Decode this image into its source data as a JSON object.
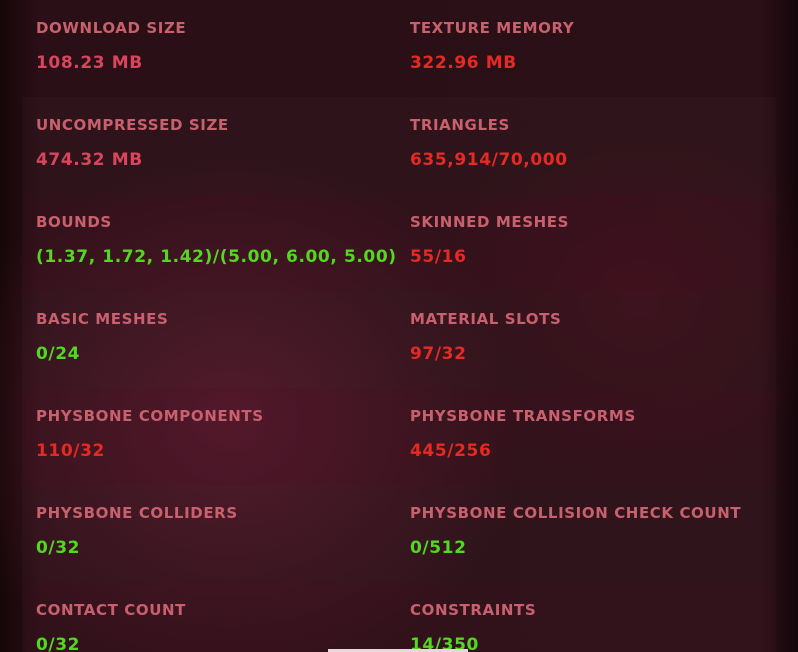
{
  "colors": {
    "label": "#c9606e",
    "value_neutral": "#d8455c",
    "value_over": "#e42a22",
    "value_ok": "#53d822",
    "background": "#1a0b10"
  },
  "stats": [
    {
      "left": {
        "label": "DOWNLOAD SIZE",
        "value": "108.23 MB",
        "status": "neutral"
      },
      "right": {
        "label": "TEXTURE MEMORY",
        "value": "322.96 MB",
        "status": "over"
      }
    },
    {
      "left": {
        "label": "UNCOMPRESSED SIZE",
        "value": "474.32 MB",
        "status": "neutral"
      },
      "right": {
        "label": "TRIANGLES",
        "value": "635,914/70,000",
        "status": "over"
      }
    },
    {
      "left": {
        "label": "BOUNDS",
        "value": "(1.37, 1.72, 1.42)/(5.00, 6.00, 5.00)",
        "status": "ok"
      },
      "right": {
        "label": "SKINNED MESHES",
        "value": "55/16",
        "status": "over"
      }
    },
    {
      "left": {
        "label": "BASIC MESHES",
        "value": "0/24",
        "status": "ok"
      },
      "right": {
        "label": "MATERIAL SLOTS",
        "value": "97/32",
        "status": "over"
      }
    },
    {
      "left": {
        "label": "PHYSBONE COMPONENTS",
        "value": "110/32",
        "status": "over"
      },
      "right": {
        "label": "PHYSBONE TRANSFORMS",
        "value": "445/256",
        "status": "over"
      }
    },
    {
      "left": {
        "label": "PHYSBONE COLLIDERS",
        "value": "0/32",
        "status": "ok"
      },
      "right": {
        "label": "PHYSBONE COLLISION CHECK COUNT",
        "value": "0/512",
        "status": "ok"
      }
    },
    {
      "left": {
        "label": "CONTACT COUNT",
        "value": "0/32",
        "status": "ok"
      },
      "right": {
        "label": "CONSTRAINTS",
        "value": "14/350",
        "status": "ok"
      }
    }
  ]
}
